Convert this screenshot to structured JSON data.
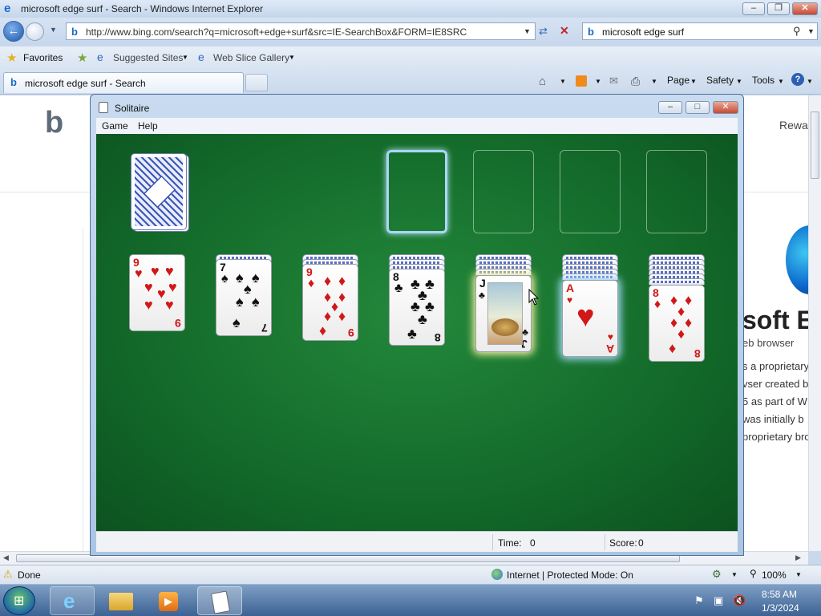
{
  "ie": {
    "title": "microsoft edge surf - Search - Windows Internet Explorer",
    "address": "http://www.bing.com/search?q=microsoft+edge+surf&src=IE-SearchBox&FORM=IE8SRC",
    "search_value": "microsoft edge surf",
    "favorites_label": "Favorites",
    "suggested_sites": "Suggested Sites",
    "web_slice": "Web Slice Gallery",
    "tab_label": "microsoft edge surf - Search",
    "page_menu": "Page",
    "safety_menu": "Safety",
    "tools_menu": "Tools",
    "status_done": "Done",
    "status_zone": "Internet | Protected Mode: On",
    "zoom": "100%"
  },
  "bing_page": {
    "rewards": "Rewa",
    "heading_fragment": "soft E",
    "subtitle_fragment": "eb browser",
    "snippet_lines": [
      "s a proprietary",
      "vser created b",
      "5 as part of W",
      "was initially b",
      "proprietary bro"
    ]
  },
  "solitaire": {
    "title": "Solitaire",
    "menu": [
      "Game",
      "Help"
    ],
    "time_label": "Time:",
    "time_value": "0",
    "score_label": "Score:",
    "score_value": "0",
    "tableau": [
      {
        "rank": "9",
        "suit": "♥",
        "color": "red"
      },
      {
        "rank": "7",
        "suit": "♠",
        "color": "blk"
      },
      {
        "rank": "9",
        "suit": "♦",
        "color": "red"
      },
      {
        "rank": "8",
        "suit": "♣",
        "color": "blk"
      },
      {
        "rank": "J",
        "suit": "♣",
        "color": "blk"
      },
      {
        "rank": "A",
        "suit": "♥",
        "color": "red"
      },
      {
        "rank": "8",
        "suit": "♦",
        "color": "red"
      }
    ]
  },
  "taskbar": {
    "time": "8:58 AM",
    "date": "1/3/2024"
  },
  "colors": {
    "felt": "#136a2a",
    "accent": "#1a6ac8"
  }
}
